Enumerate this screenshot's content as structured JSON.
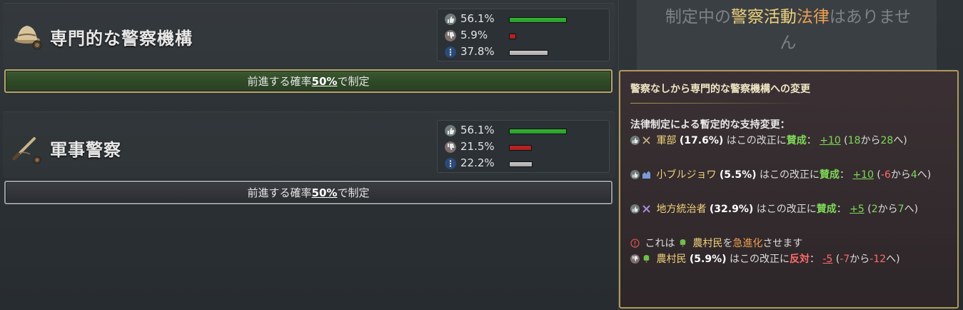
{
  "laws": [
    {
      "title": "専門的な警察機構",
      "stats": [
        {
          "icon": "thumbs-up-icon",
          "value": "56.1%",
          "bar_fraction": 0.561,
          "color": "#2fb52f"
        },
        {
          "icon": "thumbs-down-icon",
          "value": "5.9%",
          "bar_fraction": 0.059,
          "color": "#c22020"
        },
        {
          "icon": "neutral-icon",
          "value": "37.8%",
          "bar_fraction": 0.378,
          "color": "#c8c8c8"
        }
      ],
      "button": {
        "prefix": "前進する確率",
        "pct": "50%",
        "suffix": "で制定",
        "style": "green"
      }
    },
    {
      "title": "軍事警察",
      "stats": [
        {
          "icon": "thumbs-up-icon",
          "value": "56.1%",
          "bar_fraction": 0.561,
          "color": "#2fb52f"
        },
        {
          "icon": "thumbs-down-icon",
          "value": "21.5%",
          "bar_fraction": 0.215,
          "color": "#c22020"
        },
        {
          "icon": "neutral-icon",
          "value": "22.2%",
          "bar_fraction": 0.222,
          "color": "#c8c8c8"
        }
      ],
      "button": {
        "prefix": "前進する確率",
        "pct": "50%",
        "suffix": "で制定",
        "style": "dark"
      }
    }
  ],
  "no_law": {
    "part1": "制定中の",
    "part2": "警察活動",
    "part3": "法律",
    "part4": "はありませ",
    "part5": "ん"
  },
  "tooltip": {
    "title": "警察なしから専門的な警察機構への変更",
    "subtitle": "法律制定による暫定的な支持変更：",
    "groups": [
      {
        "name": "軍部",
        "pct": "(17.6%)",
        "text": "はこの改正に",
        "stance": "賛成",
        "sep": "：",
        "delta": "+10",
        "from": "18",
        "from_suffix": "から",
        "to": "28",
        "end": "へ)"
      },
      {
        "name": "小ブルジョワ",
        "pct": "(5.5%)",
        "text": "はこの改正に",
        "stance": "賛成",
        "sep": "：",
        "delta": "+10",
        "from": "-6",
        "from_suffix": "から",
        "to": "4",
        "end": "へ)"
      },
      {
        "name": "地方統治者",
        "pct": "(32.9%)",
        "text": "はこの改正に",
        "stance": "賛成",
        "sep": "：",
        "delta": "+5",
        "from": "2",
        "from_suffix": "から",
        "to": "7",
        "end": "へ)"
      }
    ],
    "radical_line": {
      "prefix": "これは",
      "group": "農村民",
      "mid": "を",
      "effect": "急進化",
      "suffix": "させます"
    },
    "oppose": {
      "name": "農村民",
      "pct": "(5.9%)",
      "text": "はこの改正に",
      "stance": "反対",
      "sep": "：",
      "delta": "-5",
      "from": "-7",
      "from_suffix": "から",
      "to": "-12",
      "end": "へ)"
    }
  },
  "colors": {
    "approve": "#7ed957",
    "oppose": "#ff6a6a",
    "accent": "#b09a5a",
    "radicalize": "#f0a050"
  }
}
